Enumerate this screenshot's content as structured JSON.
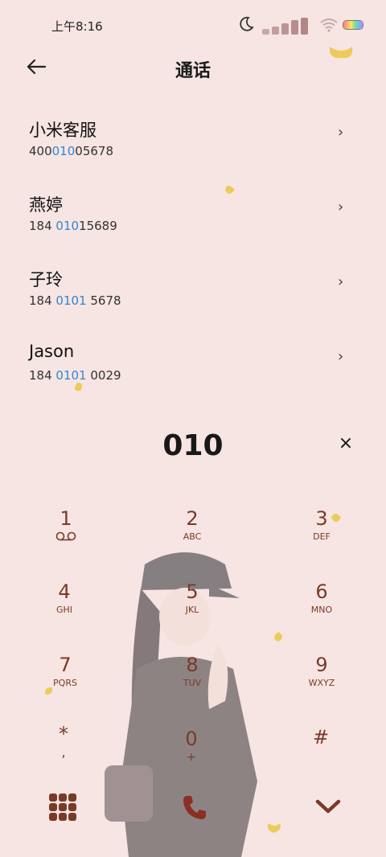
{
  "status": {
    "time": "上午8:16"
  },
  "header": {
    "title": "通话"
  },
  "contacts": [
    {
      "name": "小米客服",
      "num_pre": "400",
      "num_hl": "010",
      "num_post": "05678"
    },
    {
      "name": "燕婷",
      "num_pre": "184 ",
      "num_hl": "010",
      "num_post": "15689"
    },
    {
      "name": "子玲",
      "num_pre": "184 ",
      "num_hl": "0101",
      "num_post": " 5678"
    },
    {
      "name": "Jason",
      "num_pre": "184 ",
      "num_hl": "0101",
      "num_post": " 0029"
    }
  ],
  "chevron": "›",
  "dialer": {
    "number": "010",
    "clear": "×"
  },
  "keys": [
    {
      "digit": "1",
      "letters": ""
    },
    {
      "digit": "2",
      "letters": "ABC"
    },
    {
      "digit": "3",
      "letters": "DEF"
    },
    {
      "digit": "4",
      "letters": "GHI"
    },
    {
      "digit": "5",
      "letters": "JKL"
    },
    {
      "digit": "6",
      "letters": "MNO"
    },
    {
      "digit": "7",
      "letters": "PQRS"
    },
    {
      "digit": "8",
      "letters": "TUV"
    },
    {
      "digit": "9",
      "letters": "WXYZ"
    },
    {
      "digit": "*",
      "letters": ","
    },
    {
      "digit": "0",
      "letters": "+"
    },
    {
      "digit": "#",
      "letters": ""
    }
  ],
  "icons": {
    "back": "back-arrow-icon",
    "voicemail": "voicemail-icon",
    "grid": "dialpad-grid-icon",
    "call": "phone-icon",
    "hide": "chevron-down-icon"
  },
  "colors": {
    "background": "#f6e5e2",
    "highlight": "#2f86d8",
    "accent": "#7a3a28"
  }
}
